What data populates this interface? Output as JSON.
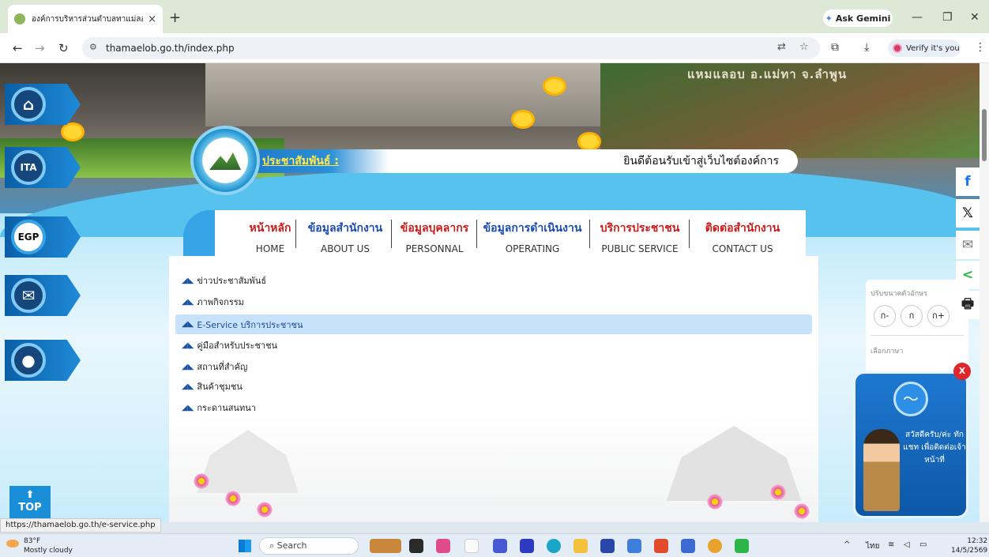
{
  "browser": {
    "tab_title": "องค์การบริหารส่วนตำบลทาแม่ลอบ ส",
    "tab_close": "×",
    "new_tab": "+",
    "ask_gemini": "Ask Gemini",
    "url": "thamaelob.go.th/index.php",
    "verify": "Verify it's you",
    "status_url": "https://thamaelob.go.th/e-service.php"
  },
  "hero": {
    "sign_text": "แหมแลอบ อ.แม่ทา จ.ลำพูน"
  },
  "banner": {
    "pr_label": "ประชาสัมพันธ์ :",
    "welcome": "ยินดีต้อนรับเข้าสู่เว็บไซต์องค์การ"
  },
  "side_nav": [
    {
      "label": "",
      "icon": "home-icon"
    },
    {
      "label": "ITA",
      "icon": "ita-icon"
    },
    {
      "label": "EGP",
      "icon": "egp-icon"
    },
    {
      "label": "",
      "icon": "mail-icon"
    },
    {
      "label": "",
      "icon": "user-icon"
    }
  ],
  "menu": [
    {
      "th": "หน้าหลัก",
      "en": "HOME"
    },
    {
      "th": "ข้อมูลสำนักงาน",
      "en": "ABOUT US"
    },
    {
      "th": "ข้อมูลบุคลากร",
      "en": "PERSONNAL"
    },
    {
      "th": "ข้อมูลการดำเนินงาน",
      "en": "OPERATING"
    },
    {
      "th": "บริการประชาชน",
      "en": "PUBLIC SERVICE"
    },
    {
      "th": "ติดต่อสำนักงาน",
      "en": "CONTACT US"
    }
  ],
  "submenu": [
    "ข่าวประชาสัมพันธ์",
    "ภาพกิจกรรม",
    "E-Service บริการประชาชน",
    "คู่มือสำหรับประชาชน",
    "สถานที่สำคัญ",
    "สินค้าชุมชน",
    "กระดานสนทนา"
  ],
  "font_panel": {
    "title": "ปรับขนาดตัวอักษร",
    "decrease": "ก-",
    "normal": "ก",
    "increase": "ก+",
    "lang_title": "เลือกภาษา",
    "google": "G"
  },
  "share": [
    "f",
    "𝕏",
    "✉",
    "<",
    "🖶"
  ],
  "messenger": {
    "text": "สวัสดีครับ/ค่ะ ทักแชท เพื่อติดต่อเจ้าหน้าที่",
    "close": "X"
  },
  "top_button": "TOP",
  "taskbar": {
    "temp": "83°F",
    "weather": "Mostly cloudy",
    "search": "Search",
    "lang": "ไทย",
    "time": "12:32",
    "date": "14/5/2569"
  }
}
